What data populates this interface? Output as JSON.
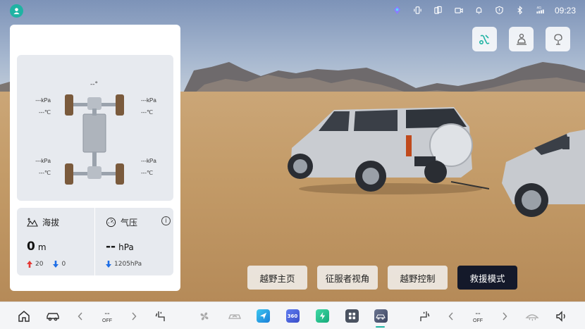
{
  "status_bar": {
    "time": "09:23",
    "icons": [
      "assistant-icon",
      "vibrate-icon",
      "phone-mirror-icon",
      "camera-icon",
      "bell-icon",
      "shield-icon",
      "bluetooth-icon",
      "signal-4g-icon"
    ],
    "signal_label": "4G"
  },
  "chassis": {
    "steering_angle": "--°",
    "front_left": {
      "pressure": "---kPa",
      "temp": "---℃"
    },
    "front_right": {
      "pressure": "---kPa",
      "temp": "---℃"
    },
    "rear_left": {
      "pressure": "---kPa",
      "temp": "---℃"
    },
    "rear_right": {
      "pressure": "---kPa",
      "temp": "---℃"
    }
  },
  "altitude": {
    "title": "海拔",
    "value": "0",
    "unit": "m",
    "up": "20",
    "down": "0"
  },
  "pressure": {
    "title": "气压",
    "value": "--",
    "unit": "hPa",
    "trend": "1205hPa"
  },
  "top_actions": [
    "tow-hook-icon",
    "driver-seat-icon",
    "tree-recovery-icon"
  ],
  "modes": [
    {
      "label": "越野主页",
      "active": false
    },
    {
      "label": "征服者视角",
      "active": false
    },
    {
      "label": "越野控制",
      "active": false
    },
    {
      "label": "救援模式",
      "active": true
    }
  ],
  "dock": {
    "left_temp": {
      "value": "--",
      "state": "OFF"
    },
    "right_temp": {
      "value": "--",
      "state": "OFF"
    },
    "app_360_label": "360"
  },
  "colors": {
    "accent": "#1fb3a3",
    "active_mode": "#14192a",
    "up_arrow": "#e53935",
    "down_arrow": "#1e6ee6"
  }
}
